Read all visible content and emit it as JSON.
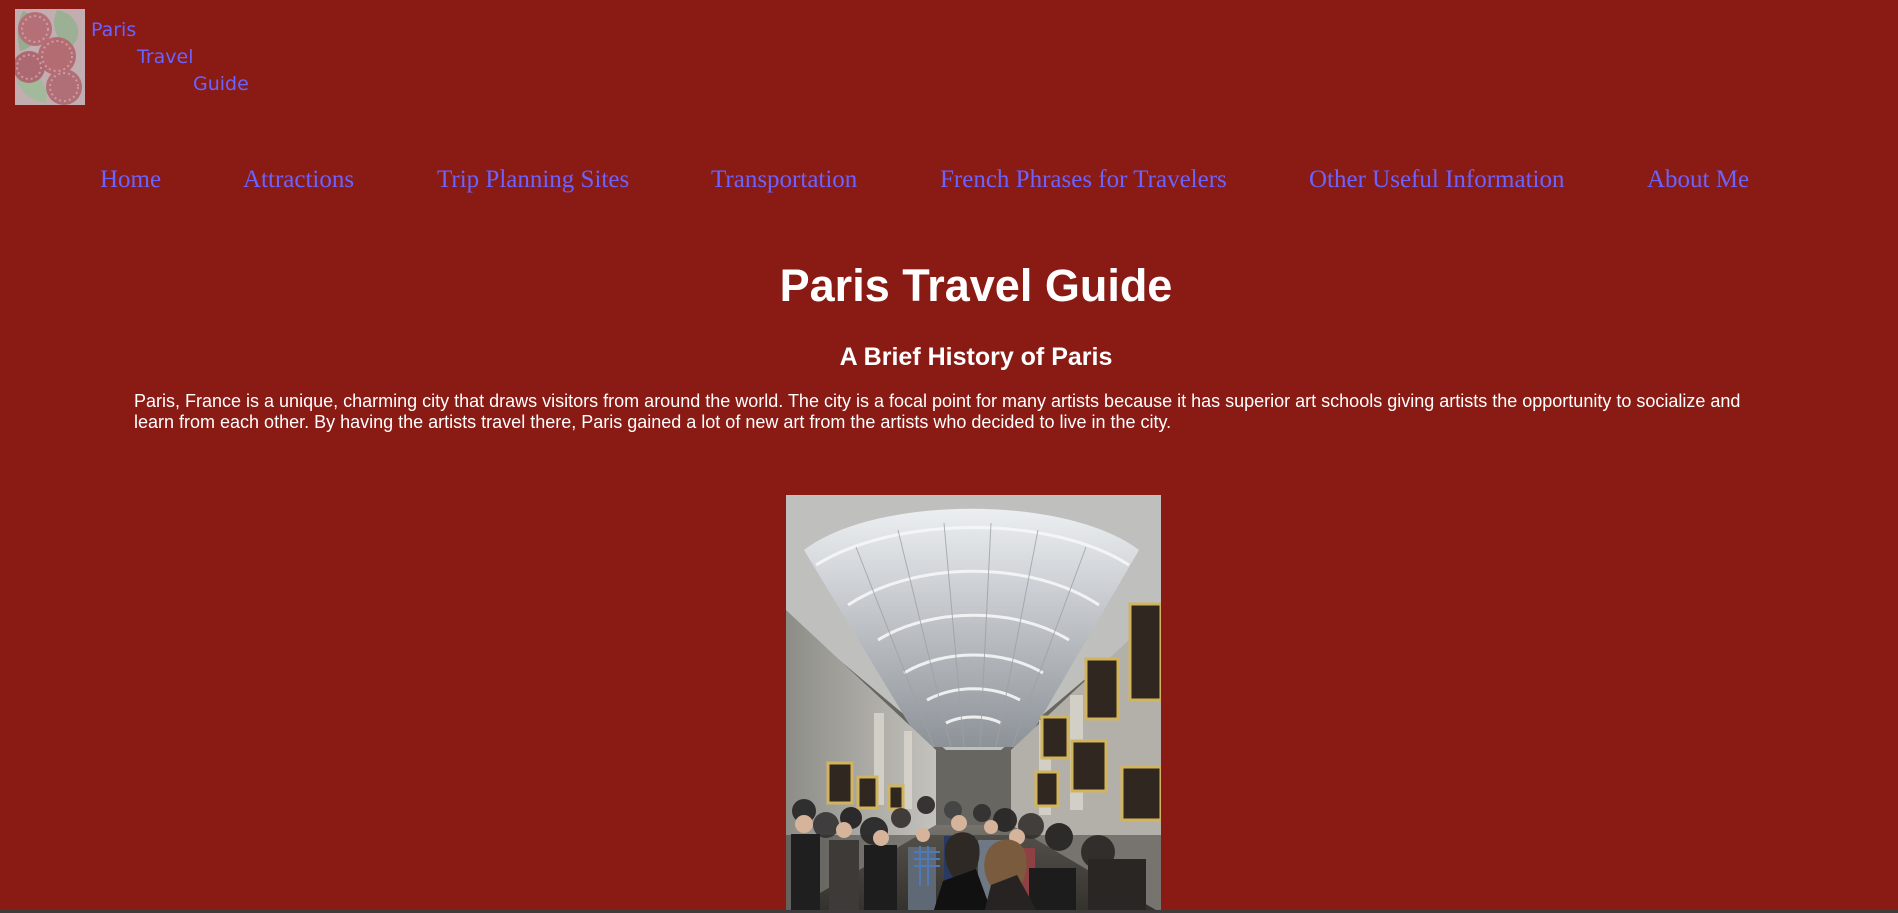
{
  "header": {
    "logo_lines": [
      "Paris",
      "Travel",
      "Guide"
    ]
  },
  "nav": {
    "items": [
      "Home",
      "Attractions",
      "Trip Planning Sites",
      "Transportation",
      "French Phrases for Travelers",
      "Other Useful Information",
      "About Me"
    ]
  },
  "main": {
    "title": "Paris Travel Guide",
    "section_heading": "A Brief History of Paris",
    "history_paragraph": "Paris, France is a unique, charming city that draws visitors from around the world. The city is a focal point for many artists because it has superior art schools giving artists the opportunity to socialize and learn from each other. By having the artists travel there, Paris gained a lot of new art from the artists who decided to live in the city."
  },
  "colors": {
    "background": "#8a1a14",
    "link": "#6a63ff",
    "text": "#ffffff"
  }
}
